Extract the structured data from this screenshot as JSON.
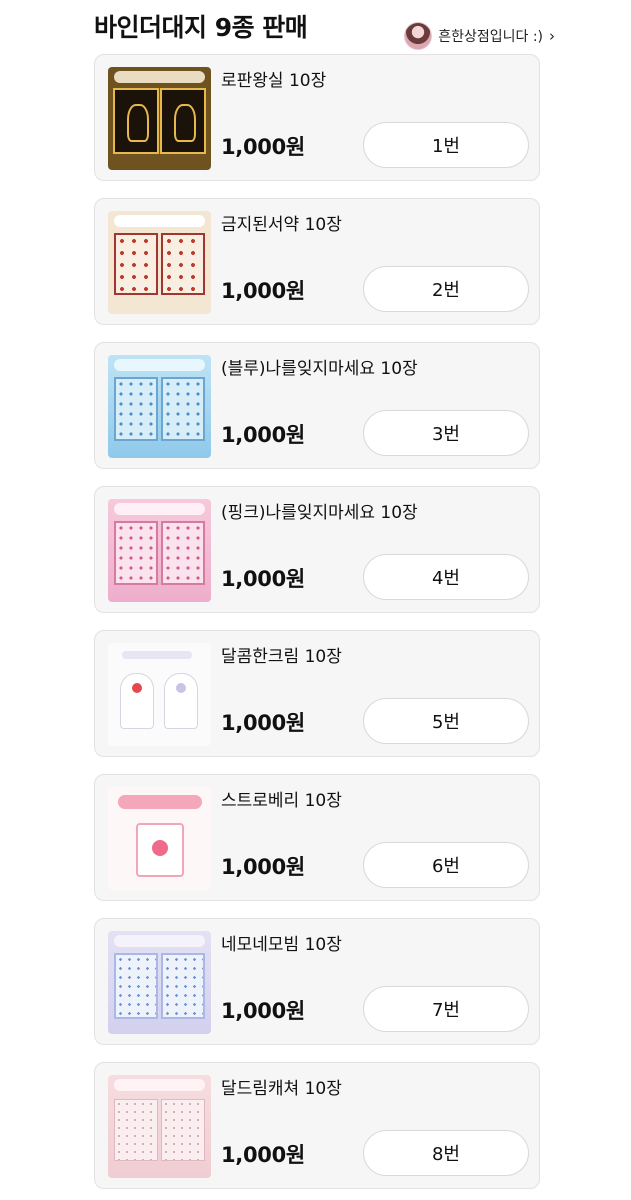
{
  "header": {
    "title": "바인더대지 9종 판매",
    "shop_name": "흔한상점입니다 :)",
    "chevron_glyph": "›"
  },
  "products": [
    {
      "name": "로판왕실 10장",
      "price": "1,000원",
      "button": "1번"
    },
    {
      "name": "금지된서약 10장",
      "price": "1,000원",
      "button": "2번"
    },
    {
      "name": "(블루)나를잊지마세요 10장",
      "price": "1,000원",
      "button": "3번"
    },
    {
      "name": "(핑크)나를잊지마세요 10장",
      "price": "1,000원",
      "button": "4번"
    },
    {
      "name": "달콤한크림 10장",
      "price": "1,000원",
      "button": "5번"
    },
    {
      "name": "스트로베리 10장",
      "price": "1,000원",
      "button": "6번"
    },
    {
      "name": "네모네모빔 10장",
      "price": "1,000원",
      "button": "7번"
    },
    {
      "name": "달드림캐쳐 10장",
      "price": "1,000원",
      "button": "8번"
    }
  ]
}
